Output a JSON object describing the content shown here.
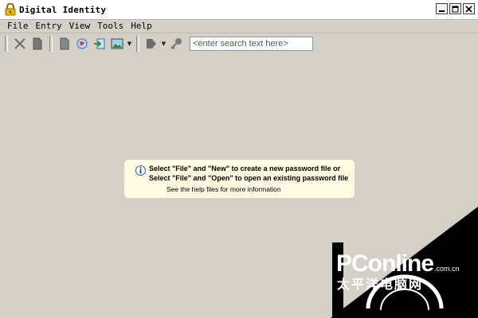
{
  "window": {
    "title": "Digital Identity",
    "controls": [
      "minimize",
      "maximize",
      "close"
    ]
  },
  "menu": [
    {
      "label": "File"
    },
    {
      "label": "Entry"
    },
    {
      "label": "View"
    },
    {
      "label": "Tools"
    },
    {
      "label": "Help"
    }
  ],
  "toolbar": {
    "search_placeholder": "<enter search text here>"
  },
  "info": {
    "line1": "Select \"File\" and \"New\" to create a new password file or",
    "line2": "Select \"File\" and \"Open\" to open an existing password file",
    "line3": "See the help files for more information"
  },
  "watermark": {
    "brand": "PConline",
    "domain": ".com.cn",
    "chinese": "太平洋电脑网"
  },
  "colors": {
    "background": "#d4d0c8",
    "info_background": "#fffbe3",
    "watermark": "#000000"
  }
}
